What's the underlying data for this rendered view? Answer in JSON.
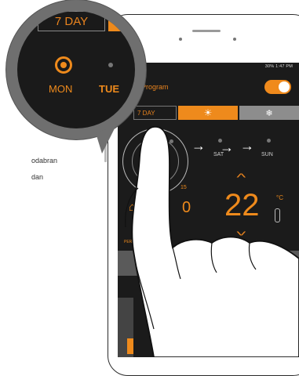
{
  "side_text": [
    "odabran",
    "dan"
  ],
  "status_bar": "30% 1:47 PM",
  "header": {
    "program_label": "Program",
    "toggle_on": true
  },
  "tabs": {
    "mode_label": "7 DAY",
    "sun_icon": "sun-icon",
    "snow_icon": "snowflake-icon"
  },
  "days": {
    "sat": "SAT",
    "sun": "SUN"
  },
  "temperature": {
    "value": "22",
    "unit": "°C",
    "prev_value": "0",
    "time_hint": "15"
  },
  "period_label": "PERIOD",
  "bubble": {
    "mode_label": "7 DAY",
    "day_mon": "MON",
    "day_tue": "TUE"
  },
  "colors": {
    "accent": "#ee8a1c",
    "screen_bg": "#1b1b1b"
  }
}
